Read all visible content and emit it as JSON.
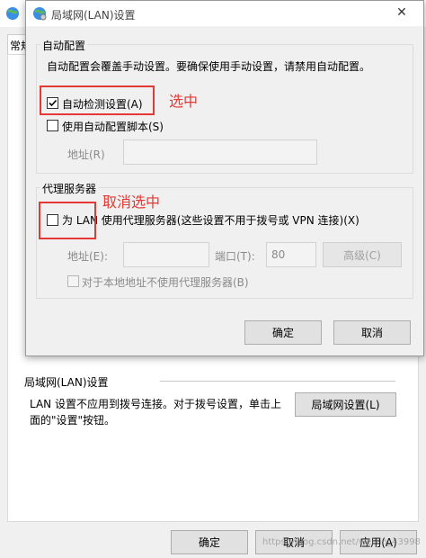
{
  "parent": {
    "tab_label": "常规",
    "lan_section_title": "局域网(LAN)设置",
    "lan_desc_line1": "LAN 设置不应用到拨号连接。对于拨号设置，单击上",
    "lan_desc_line2": "面的\"设置\"按钮。",
    "lan_settings_button": "局域网设置(L)",
    "ok_button": "确定",
    "cancel_button": "取消",
    "apply_button": "应用(A)",
    "watermark": "https://blog.csdn.net/weixin_43998"
  },
  "dialog": {
    "title": "局域网(LAN)设置",
    "close_glyph": "✕",
    "auto_config": {
      "group_title": "自动配置",
      "description": "自动配置会覆盖手动设置。要确保使用手动设置，请禁用自动配置。",
      "auto_detect_label": "自动检测设置(A)",
      "auto_detect_checked": true,
      "use_script_label": "使用自动配置脚本(S)",
      "use_script_checked": false,
      "address_label": "地址(R)",
      "address_value": ""
    },
    "proxy": {
      "group_title": "代理服务器",
      "use_proxy_label": "为 LAN 使用代理服务器(这些设置不用于拨号或 VPN 连接)(X)",
      "use_proxy_checked": false,
      "address_label": "地址(E):",
      "address_value": "",
      "port_label": "端口(T):",
      "port_value": "80",
      "advanced_button": "高级(C)",
      "bypass_label": "对于本地地址不使用代理服务器(B)",
      "bypass_checked": false
    },
    "ok_button": "确定",
    "cancel_button": "取消"
  },
  "annotations": {
    "selected_note": "选中",
    "deselected_note": "取消选中"
  },
  "colors": {
    "annotation_red": "#e53935",
    "window_bg": "#f0f0f0"
  },
  "icons": {
    "title_icon": "globe-settings-icon",
    "close_icon": "close-icon",
    "checkmark": "checkmark-icon"
  }
}
